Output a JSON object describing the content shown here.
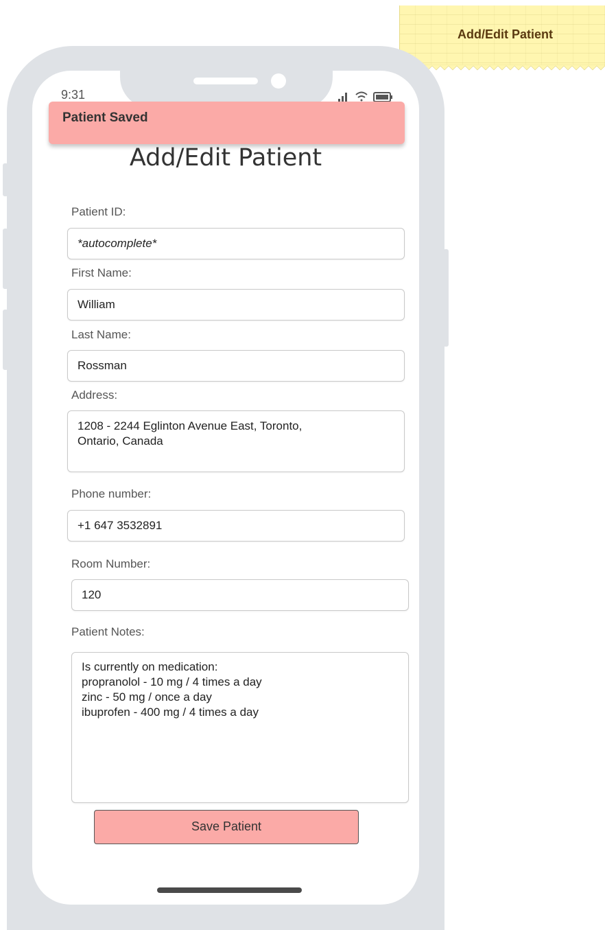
{
  "annotation": {
    "label": "Add/Edit Patient"
  },
  "status_bar": {
    "time": "9:31",
    "icons": [
      "signal-icon",
      "wifi-icon",
      "battery-icon"
    ]
  },
  "toast": {
    "message": "Patient Saved",
    "color": "#fbaaa7"
  },
  "page": {
    "title": "Add/Edit Patient"
  },
  "form": {
    "patient_id": {
      "label": "Patient ID:",
      "value": "*autocomplete*"
    },
    "first_name": {
      "label": "First Name:",
      "value": "William"
    },
    "last_name": {
      "label": "Last Name:",
      "value": "Rossman"
    },
    "address": {
      "label": "Address:",
      "value": "1208 - 2244 Eglinton Avenue East, Toronto,\nOntario, Canada"
    },
    "phone": {
      "label": "Phone number:",
      "value": "+1 647 3532891"
    },
    "room": {
      "label": "Room Number:",
      "value": "120"
    },
    "notes": {
      "label": "Patient Notes:",
      "value": "Is currently on medication:\npropranolol - 10 mg / 4 times a day\nzinc - 50 mg / once a day\nibuprofen - 400 mg / 4 times a day"
    },
    "save_label": "Save Patient"
  },
  "colors": {
    "accent": "#fbaaa7",
    "frame": "#dfe2e6",
    "sticky_note": "#fff6b0"
  }
}
